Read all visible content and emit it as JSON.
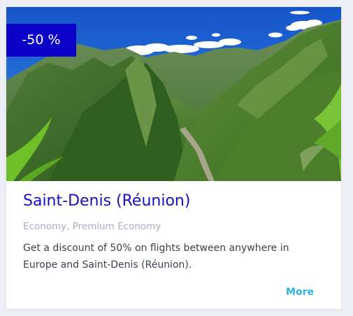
{
  "offer": {
    "discount_badge": "-50 %",
    "title": "Saint-Denis (Réunion)",
    "travel_classes": "Economy, Premium Economy",
    "description": "Get a discount of 50% on flights between anywhere in Europe and Saint-Denis (Réunion).",
    "more_label": "More"
  },
  "colors": {
    "page_background": "#eeeef6",
    "badge_background": "#0a00c8",
    "title": "#1810c0",
    "muted_text": "#a8abbc",
    "body_text": "#3a3f52",
    "link": "#2bb3ea"
  }
}
